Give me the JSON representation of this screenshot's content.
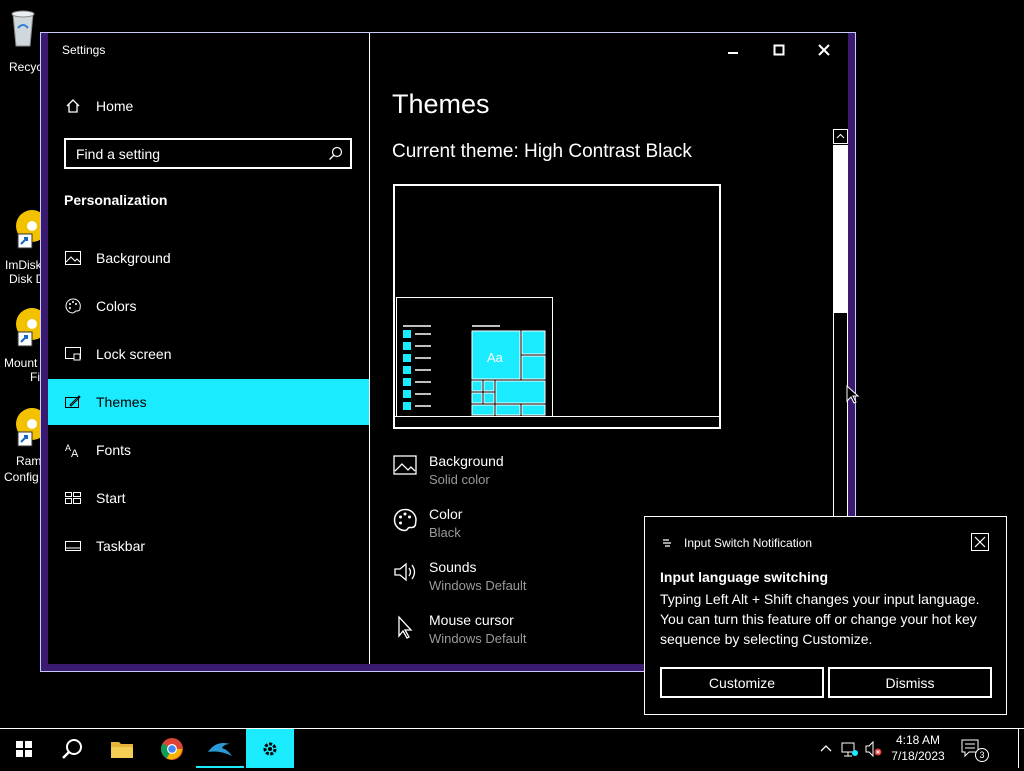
{
  "desktop": {
    "icons": [
      {
        "label": "Recycl",
        "icon": "recycle-bin-icon"
      },
      {
        "label": "ImDisk",
        "label2": "Disk D",
        "icon": "imdisk-icon"
      },
      {
        "label": "Mount",
        "label2": "Fi",
        "icon": "mount-icon"
      },
      {
        "label": "Ram",
        "label2": "Config",
        "icon": "ram-config-icon"
      }
    ]
  },
  "window": {
    "title": "Settings",
    "controls": {
      "minimize": "—",
      "maximize": "☐",
      "close": "✕"
    }
  },
  "sidebar": {
    "home": "Home",
    "search_placeholder": "Find a setting",
    "section": "Personalization",
    "items": [
      {
        "label": "Background",
        "icon": "picture-icon"
      },
      {
        "label": "Colors",
        "icon": "palette-icon"
      },
      {
        "label": "Lock screen",
        "icon": "lock-screen-icon"
      },
      {
        "label": "Themes",
        "icon": "themes-icon",
        "selected": true
      },
      {
        "label": "Fonts",
        "icon": "fonts-icon"
      },
      {
        "label": "Start",
        "icon": "start-icon"
      },
      {
        "label": "Taskbar",
        "icon": "taskbar-icon"
      }
    ]
  },
  "main": {
    "title": "Themes",
    "current_theme": "Current theme: High Contrast Black",
    "preview_tile_text": "Aa",
    "properties": [
      {
        "name": "Background",
        "value": "Solid color",
        "icon": "picture-icon"
      },
      {
        "name": "Color",
        "value": "Black",
        "icon": "palette-icon"
      },
      {
        "name": "Sounds",
        "value": "Windows Default",
        "icon": "speaker-icon"
      },
      {
        "name": "Mouse cursor",
        "value": "Windows Default",
        "icon": "cursor-icon"
      }
    ]
  },
  "notification": {
    "app": "Input Switch Notification",
    "heading": "Input language switching",
    "body": "Typing Left Alt + Shift changes your input language. You can turn this feature off or change your hot key sequence by selecting Customize.",
    "customize": "Customize",
    "dismiss": "Dismiss"
  },
  "taskbar": {
    "time": "4:18 AM",
    "date": "7/18/2023",
    "notification_count": "3",
    "apps": [
      "start-icon",
      "search-icon",
      "file-explorer-icon",
      "chrome-icon",
      "dolphin-icon",
      "settings-icon"
    ]
  },
  "colors": {
    "accent": "#1aebff",
    "frame": "#3a1a6e"
  }
}
